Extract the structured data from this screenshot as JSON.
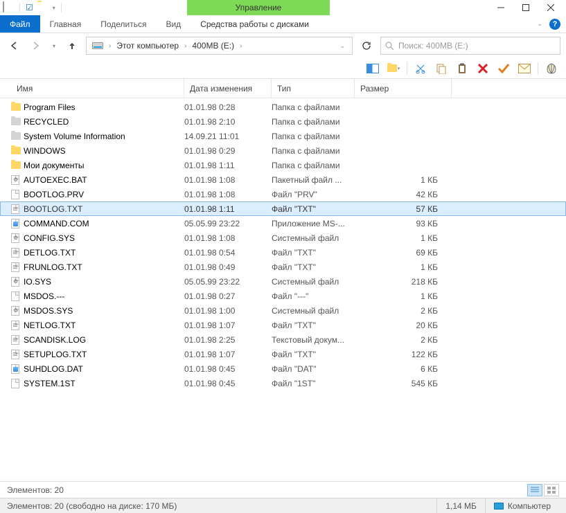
{
  "window": {
    "title": "400MB (E:)",
    "context_tab": "Управление"
  },
  "ribbon": {
    "file_tab": "Файл",
    "tabs": [
      "Главная",
      "Поделиться",
      "Вид",
      "Средства работы с дисками"
    ]
  },
  "breadcrumb": {
    "pc": "Этот компьютер",
    "current": "400MB (E:)"
  },
  "search": {
    "placeholder": "Поиск: 400MB (E:)"
  },
  "columns": {
    "name": "Имя",
    "date": "Дата изменения",
    "type": "Тип",
    "size": "Размер"
  },
  "files": [
    {
      "name": "Program Files",
      "date": "01.01.98 0:28",
      "type": "Папка с файлами",
      "size": "",
      "icon": "folder"
    },
    {
      "name": "RECYCLED",
      "date": "01.01.98 2:10",
      "type": "Папка с файлами",
      "size": "",
      "icon": "folder-grey"
    },
    {
      "name": "System Volume Information",
      "date": "14.09.21 11:01",
      "type": "Папка с файлами",
      "size": "",
      "icon": "folder-grey"
    },
    {
      "name": "WINDOWS",
      "date": "01.01.98 0:29",
      "type": "Папка с файлами",
      "size": "",
      "icon": "folder"
    },
    {
      "name": "Мои документы",
      "date": "01.01.98 1:11",
      "type": "Папка с файлами",
      "size": "",
      "icon": "folder"
    },
    {
      "name": "AUTOEXEC.BAT",
      "date": "01.01.98 1:08",
      "type": "Пакетный файл ...",
      "size": "1 КБ",
      "icon": "gear"
    },
    {
      "name": "BOOTLOG.PRV",
      "date": "01.01.98 1:08",
      "type": "Файл \"PRV\"",
      "size": "42 КБ",
      "icon": "file"
    },
    {
      "name": "BOOTLOG.TXT",
      "date": "01.01.98 1:11",
      "type": "Файл \"TXT\"",
      "size": "57 КБ",
      "icon": "txt",
      "selected": true
    },
    {
      "name": "COMMAND.COM",
      "date": "05.05.99 23:22",
      "type": "Приложение MS-...",
      "size": "93 КБ",
      "icon": "exe"
    },
    {
      "name": "CONFIG.SYS",
      "date": "01.01.98 1:08",
      "type": "Системный файл",
      "size": "1 КБ",
      "icon": "gear"
    },
    {
      "name": "DETLOG.TXT",
      "date": "01.01.98 0:54",
      "type": "Файл \"TXT\"",
      "size": "69 КБ",
      "icon": "txt"
    },
    {
      "name": "FRUNLOG.TXT",
      "date": "01.01.98 0:49",
      "type": "Файл \"TXT\"",
      "size": "1 КБ",
      "icon": "txt"
    },
    {
      "name": "IO.SYS",
      "date": "05.05.99 23:22",
      "type": "Системный файл",
      "size": "218 КБ",
      "icon": "gear"
    },
    {
      "name": "MSDOS.---",
      "date": "01.01.98 0:27",
      "type": "Файл \"---\"",
      "size": "1 КБ",
      "icon": "file"
    },
    {
      "name": "MSDOS.SYS",
      "date": "01.01.98 1:00",
      "type": "Системный файл",
      "size": "2 КБ",
      "icon": "gear"
    },
    {
      "name": "NETLOG.TXT",
      "date": "01.01.98 1:07",
      "type": "Файл \"TXT\"",
      "size": "20 КБ",
      "icon": "txt"
    },
    {
      "name": "SCANDISK.LOG",
      "date": "01.01.98 2:25",
      "type": "Текстовый докум...",
      "size": "2 КБ",
      "icon": "txt"
    },
    {
      "name": "SETUPLOG.TXT",
      "date": "01.01.98 1:07",
      "type": "Файл \"TXT\"",
      "size": "122 КБ",
      "icon": "txt"
    },
    {
      "name": "SUHDLOG.DAT",
      "date": "01.01.98 0:45",
      "type": "Файл \"DAT\"",
      "size": "6 КБ",
      "icon": "exe"
    },
    {
      "name": "SYSTEM.1ST",
      "date": "01.01.98 0:45",
      "type": "Файл \"1ST\"",
      "size": "545 КБ",
      "icon": "file"
    }
  ],
  "status1": {
    "count": "Элементов: 20"
  },
  "status2": {
    "left": "Элементов: 20 (свободно на диске: 170 МБ)",
    "size": "1,14 МБ",
    "location": "Компьютер"
  }
}
